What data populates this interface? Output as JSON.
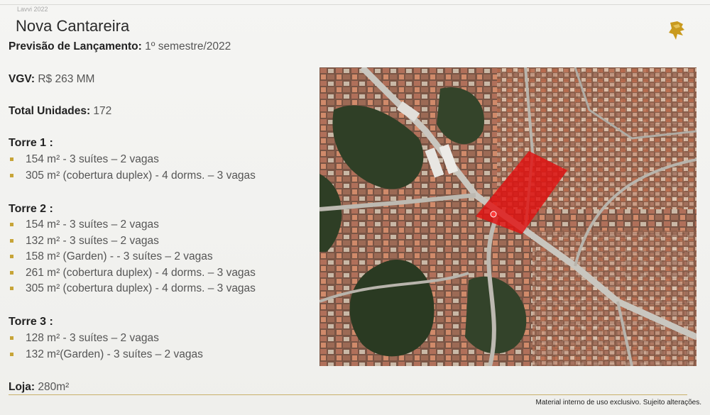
{
  "header": {
    "brand": "Lavvi 2022",
    "title": "Nova Cantareira"
  },
  "launch": {
    "label": "Previsão de Lançamento:",
    "value": "1º semestre/2022"
  },
  "vgv": {
    "label": "VGV:",
    "value": "R$ 263 MM"
  },
  "units": {
    "label": "Total Unidades:",
    "value": "172"
  },
  "towers": [
    {
      "title": "Torre 1 :",
      "items": [
        "154 m² - 3 suítes – 2 vagas",
        "305 m² (cobertura duplex) - 4 dorms. – 3 vagas"
      ]
    },
    {
      "title": "Torre 2 :",
      "items": [
        "154 m² - 3 suítes – 2 vagas",
        "132 m² - 3 suítes – 2 vagas",
        "158 m² (Garden) - - 3 suítes – 2 vagas",
        "261 m² (cobertura duplex) - 4 dorms. – 3 vagas",
        "305 m² (cobertura duplex) - 4 dorms. – 3 vagas"
      ]
    },
    {
      "title": "Torre 3 :",
      "items": [
        "128 m² - 3 suítes – 2 vagas",
        "132 m²(Garden) - 3 suítes – 2 vagas"
      ]
    }
  ],
  "store": {
    "label": "Loja:",
    "value": "280m²"
  },
  "footer": {
    "note": "Material interno de uso exclusivo. Sujeito alterações."
  },
  "map": {
    "icon": "satellite-map",
    "plot_color": "#e01010"
  },
  "colors": {
    "accent": "#c7a437",
    "logo": "#c99a1e"
  }
}
